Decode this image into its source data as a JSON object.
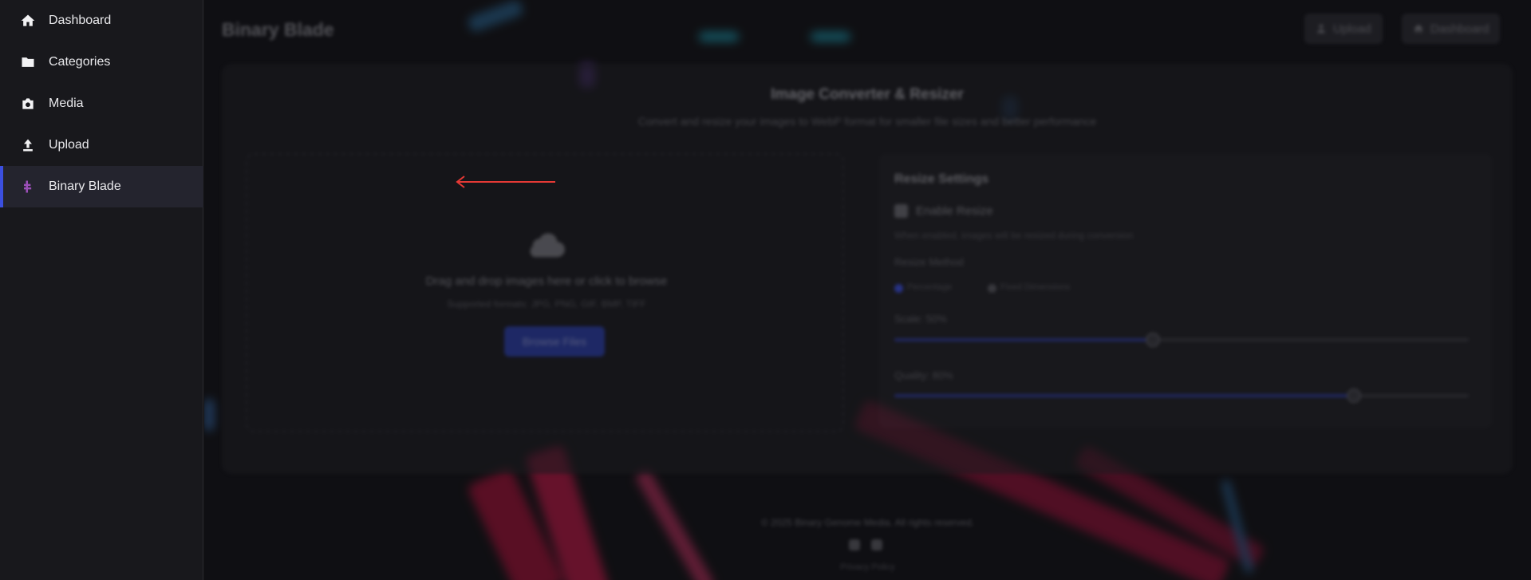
{
  "sidebar": {
    "items": [
      {
        "label": "Dashboard",
        "icon": "home-icon"
      },
      {
        "label": "Categories",
        "icon": "folder-icon"
      },
      {
        "label": "Media",
        "icon": "camera-icon"
      },
      {
        "label": "Upload",
        "icon": "upload-icon"
      },
      {
        "label": "Binary Blade",
        "icon": "binary-blade-icon",
        "active": true
      }
    ]
  },
  "header": {
    "title": "Binary Blade",
    "upload_label": "Upload",
    "dashboard_label": "Dashboard"
  },
  "converter": {
    "title": "Image Converter & Resizer",
    "subtitle": "Convert and resize your images to WebP format for smaller file sizes and better performance",
    "drop_text": "Drag and drop images here or click to browse",
    "formats_text": "Supported formats: JPG, PNG, GIF, BMP, TIFF",
    "browse_label": "Browse Files"
  },
  "settings": {
    "title": "Resize Settings",
    "enable_label": "Enable Resize",
    "note": "When enabled, images will be resized during conversion",
    "method_label": "Resize Method",
    "method_options": [
      "Percentage",
      "Fixed Dimensions"
    ],
    "scale_label": "Scale: 50%",
    "scale_value": 0.45,
    "quality_label": "Quality: 80%",
    "quality_value": 0.8
  },
  "footer": {
    "copyright": "© 2025 Binary Genome Media. All rights reserved.",
    "link": "Privacy Policy"
  },
  "colors": {
    "accent": "#3b4fe0",
    "active_icon": "#9b4fb8",
    "arrow": "#e53935"
  }
}
